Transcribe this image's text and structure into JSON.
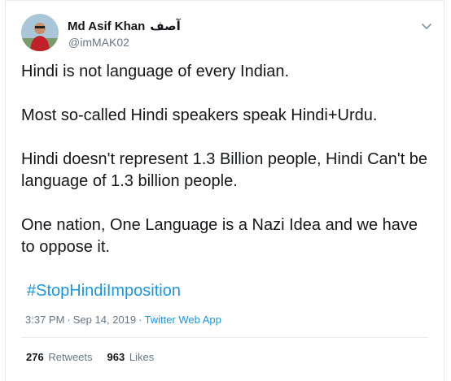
{
  "author": {
    "name": "Md Asif Khan",
    "name_alt": "آصف",
    "handle": "@imMAK02"
  },
  "tweet": {
    "paragraphs": [
      "Hindi is not language of every Indian.",
      "Most so-called Hindi speakers speak Hindi+Urdu.",
      "Hindi doesn't represent 1.3 Billion people, Hindi Can't be language of 1.3 billion people.",
      "One nation, One Language is a Nazi Idea and we have to oppose it."
    ],
    "hashtag": "#StopHindiImposition"
  },
  "meta": {
    "time": "3:37 PM",
    "separator": "·",
    "date": "Sep 14, 2019",
    "source": "Twitter Web App"
  },
  "stats": {
    "retweets_count": "276",
    "retweets_label": "Retweets",
    "likes_count": "963",
    "likes_label": "Likes"
  },
  "colors": {
    "link": "#1b95e0",
    "secondary_text": "#657786",
    "border": "#e6ecf0"
  },
  "icons": {
    "caret": "chevron-down-icon"
  }
}
